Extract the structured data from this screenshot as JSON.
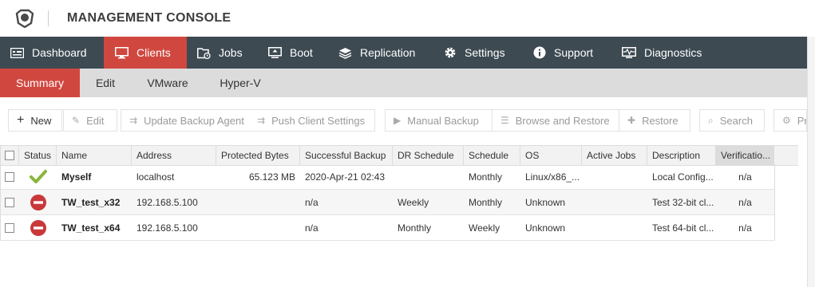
{
  "app": {
    "title": "MANAGEMENT CONSOLE"
  },
  "main_nav": [
    {
      "label": "Dashboard",
      "icon": "dashboard-icon",
      "active": false
    },
    {
      "label": "Clients",
      "icon": "monitor-icon",
      "active": true
    },
    {
      "label": "Jobs",
      "icon": "jobs-icon",
      "active": false
    },
    {
      "label": "Boot",
      "icon": "boot-icon",
      "active": false
    },
    {
      "label": "Replication",
      "icon": "layers-icon",
      "active": false
    },
    {
      "label": "Settings",
      "icon": "gear-icon",
      "active": false
    },
    {
      "label": "Support",
      "icon": "info-icon",
      "active": false
    },
    {
      "label": "Diagnostics",
      "icon": "pulse-icon",
      "active": false
    }
  ],
  "sub_nav": [
    {
      "label": "Summary",
      "active": true
    },
    {
      "label": "Edit",
      "active": false
    },
    {
      "label": "VMware",
      "active": false
    },
    {
      "label": "Hyper-V",
      "active": false
    }
  ],
  "toolbar": {
    "new": "New",
    "edit": "Edit",
    "update_agent": "Update Backup Agent",
    "push_settings": "Push Client Settings",
    "manual_backup": "Manual Backup",
    "browse_restore": "Browse and Restore",
    "restore": "Restore",
    "search": "Search",
    "pro": "Pro"
  },
  "table": {
    "columns": [
      "Status",
      "Name",
      "Address",
      "Protected Bytes",
      "Successful Backup",
      "DR Schedule",
      "Schedule",
      "OS",
      "Active Jobs",
      "Description",
      "Verificatio..."
    ],
    "rows": [
      {
        "status": "ok",
        "name": "Myself",
        "address": "localhost",
        "protected_bytes": "65.123 MB",
        "successful_backup": "2020-Apr-21 02:43",
        "dr_schedule": "",
        "schedule": "Monthly",
        "os": "Linux/x86_...",
        "active_jobs": "",
        "description": "Local Config...",
        "verification": "n/a"
      },
      {
        "status": "error",
        "name": "TW_test_x32",
        "address": "192.168.5.100",
        "protected_bytes": "",
        "successful_backup": "n/a",
        "dr_schedule": "Weekly",
        "schedule": "Monthly",
        "os": "Unknown",
        "active_jobs": "",
        "description": "Test 32-bit cl...",
        "verification": "n/a"
      },
      {
        "status": "error",
        "name": "TW_test_x64",
        "address": "192.168.5.100",
        "protected_bytes": "",
        "successful_backup": "n/a",
        "dr_schedule": "Monthly",
        "schedule": "Weekly",
        "os": "Unknown",
        "active_jobs": "",
        "description": "Test 64-bit cl...",
        "verification": "n/a"
      }
    ]
  },
  "colors": {
    "accent": "#d0473f",
    "nav_bg": "#3d4a52",
    "subnav_bg": "#dcdcdc",
    "ok": "#8ab53b",
    "error": "#c9383a"
  }
}
